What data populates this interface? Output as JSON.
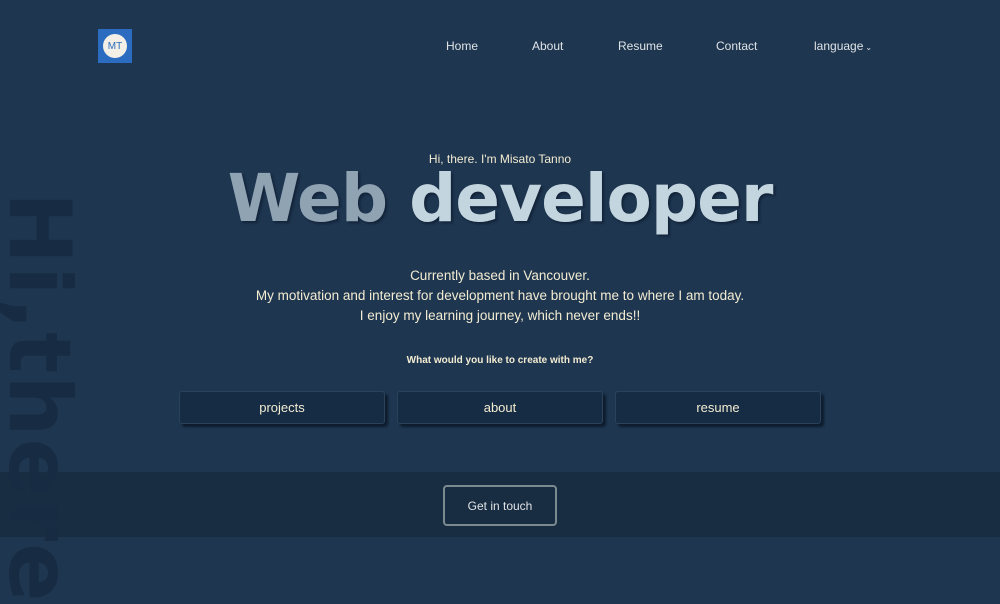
{
  "logo": {
    "initials": "MT"
  },
  "nav": {
    "items": [
      "Home",
      "About",
      "Resume",
      "Contact"
    ],
    "language": "language"
  },
  "hero": {
    "greeting": "Hi, there. I'm Misato Tanno",
    "title_word1": "Web",
    "title_word2": "developer",
    "desc": [
      "Currently based in Vancouver.",
      "My motivation and interest for development have brought me to where I am today.",
      "I enjoy my learning journey, which never ends!!"
    ],
    "question": "What would you like to create with me?"
  },
  "buttons": [
    "projects",
    "about",
    "resume"
  ],
  "side_text": "Hi,there",
  "footer": {
    "cta": "Get in touch"
  }
}
